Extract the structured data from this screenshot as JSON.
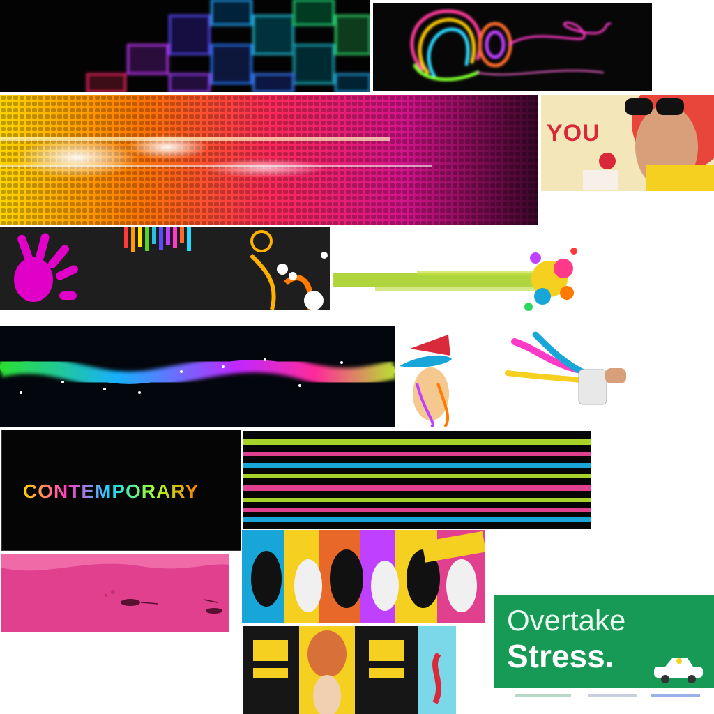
{
  "collage": {
    "you_text": "YOU",
    "contemporary_text": "CONTEMPORARY",
    "overtake_line1": "Overtake",
    "overtake_line2": "Stress."
  },
  "colors": {
    "page_background": "#ffffff",
    "dark_background": "#050505",
    "pink": "#e0408e",
    "lime": "#a6d22a",
    "cyan": "#18a6d8",
    "magenta": "#e000c8",
    "orange": "#ff8a00",
    "green_banner": "#169a55",
    "cream": "#f3e6b8"
  }
}
